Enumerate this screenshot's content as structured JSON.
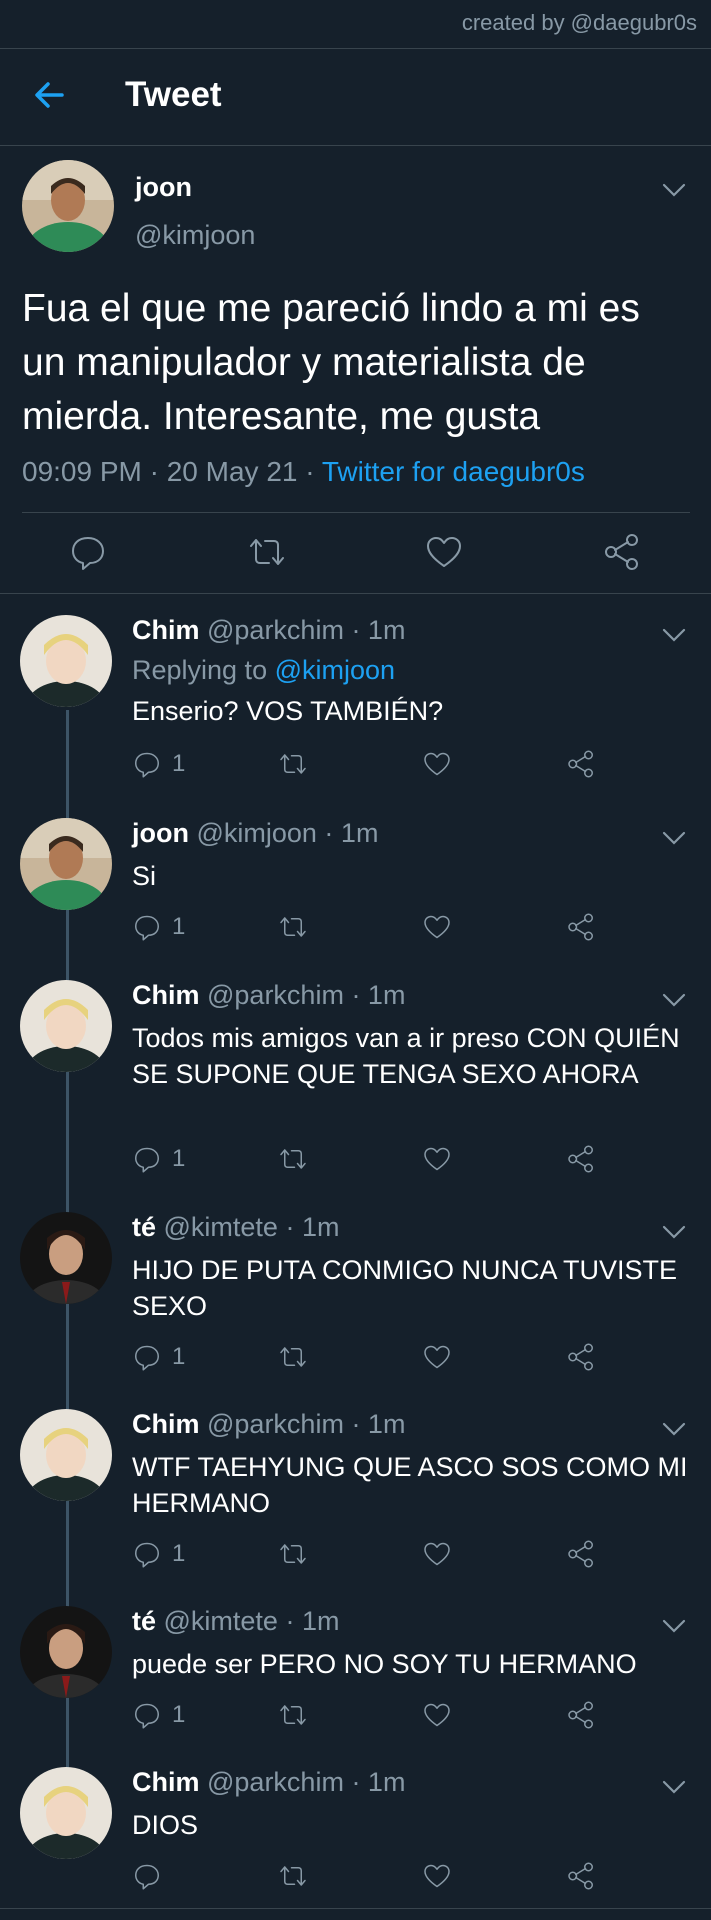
{
  "credit": "created by @daegubr0s",
  "header": {
    "title": "Tweet"
  },
  "main_tweet": {
    "name": "joon",
    "handle": "@kimjoon",
    "text": "Fua el que me pareció lindo a mi es un manipulador y materialista de mierda. Interesante, me gusta",
    "time": "09:09 PM · 20 May 21 · ",
    "source": "Twitter for daegubr0s"
  },
  "replies": [
    {
      "name": "Chim",
      "meta": " @parkchim · 1m",
      "replying_prefix": "Replying to ",
      "replying_to": "@kimjoon",
      "text": "Enserio? VOS TAMBIÉN?",
      "reply_count": "1",
      "avatar": "chim"
    },
    {
      "name": "joon",
      "meta": " @kimjoon · 1m",
      "text": "Si",
      "reply_count": "1",
      "avatar": "joon"
    },
    {
      "name": "Chim",
      "meta": " @parkchim · 1m",
      "text": "Todos mis amigos van a ir preso CON QUIÉN SE SUPONE QUE TENGA SEXO AHORA",
      "reply_count": "1",
      "avatar": "chim"
    },
    {
      "name": "té",
      "meta": " @kimtete · 1m",
      "text": "HIJO DE PUTA CONMIGO NUNCA TUVISTE SEXO",
      "reply_count": "1",
      "avatar": "te"
    },
    {
      "name": "Chim",
      "meta": " @parkchim · 1m",
      "text": "WTF TAEHYUNG QUE ASCO SOS COMO MI HERMANO",
      "reply_count": "1",
      "avatar": "chim"
    },
    {
      "name": "té",
      "meta": " @kimtete · 1m",
      "text": "puede ser PERO NO SOY TU HERMANO",
      "reply_count": "1",
      "avatar": "te"
    },
    {
      "name": "Chim",
      "meta": " @parkchim · 1m",
      "text": "DIOS",
      "reply_count": "",
      "avatar": "chim"
    }
  ],
  "colors": {
    "background": "#15202b",
    "accent": "#1da1f2",
    "muted": "#8899a6",
    "divider": "#38444d"
  }
}
